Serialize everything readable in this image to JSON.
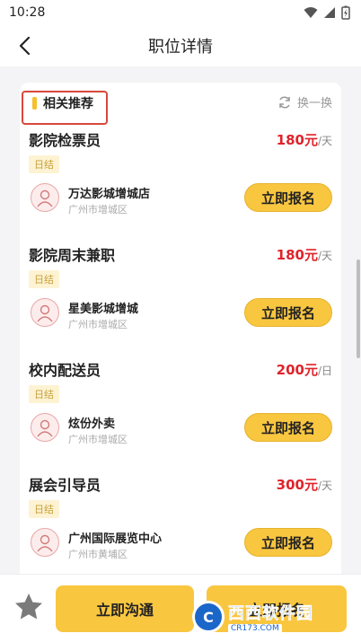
{
  "status_bar": {
    "time": "10:28"
  },
  "nav": {
    "title": "职位详情"
  },
  "section": {
    "title": "相关推荐",
    "refresh_label": "换一换"
  },
  "jobs": [
    {
      "title": "影院检票员",
      "salary": "180元",
      "unit": "/天",
      "tag": "日结",
      "company": "万达影城增城店",
      "location": "广州市增城区",
      "apply_label": "立即报名"
    },
    {
      "title": "影院周末兼职",
      "salary": "180元",
      "unit": "/天",
      "tag": "日结",
      "company": "星美影城增城",
      "location": "广州市增城区",
      "apply_label": "立即报名"
    },
    {
      "title": "校内配送员",
      "salary": "200元",
      "unit": "/日",
      "tag": "日结",
      "company": "炫份外卖",
      "location": "广州市增城区",
      "apply_label": "立即报名"
    },
    {
      "title": "展会引导员",
      "salary": "300元",
      "unit": "/天",
      "tag": "日结",
      "company": "广州国际展览中心",
      "location": "广州市黄埔区",
      "apply_label": "立即报名"
    }
  ],
  "bottom": {
    "chat_label": "立即沟通",
    "signup_label": "立即报名"
  },
  "watermark": {
    "brand": "西西软件园",
    "domain": "CR173.COM"
  },
  "colors": {
    "accent": "#f9c640",
    "salary": "#e0232a",
    "highlight": "#d8483c"
  },
  "icons": {
    "back": "back-arrow-icon",
    "refresh": "refresh-icon",
    "favorite": "star-icon",
    "avatar": "user-avatar-icon"
  }
}
